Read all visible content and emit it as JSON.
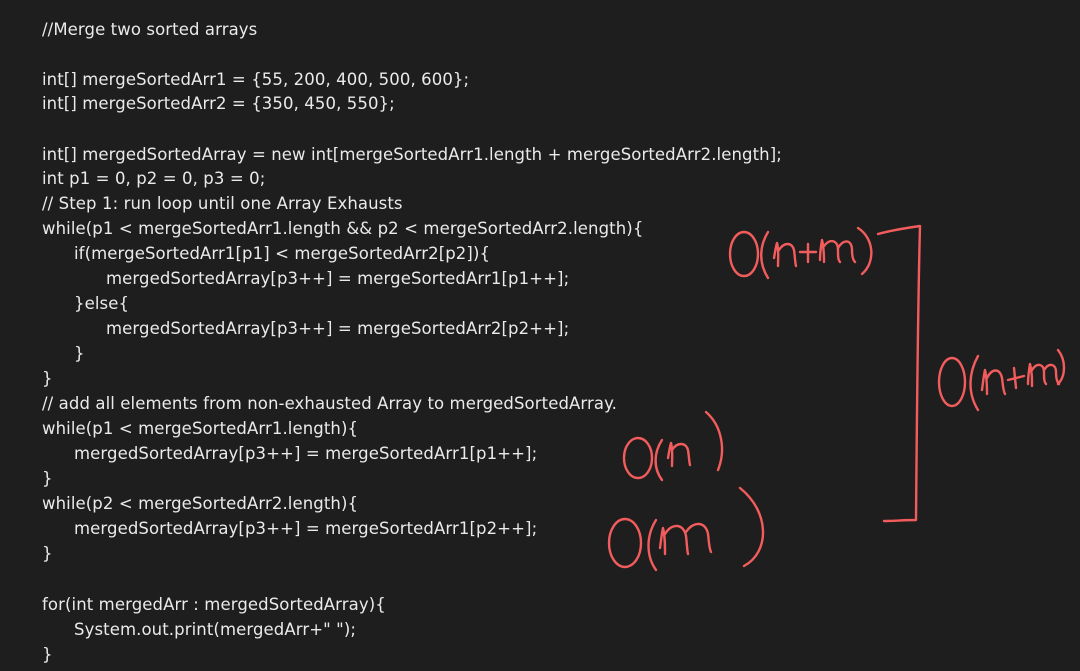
{
  "code": {
    "lines": [
      "//Merge two sorted arrays",
      "int[] mergeSortedArr1 = {55, 200, 400, 500, 600};",
      "int[] mergeSortedArr2 = {350, 450, 550};",
      "int[] mergedSortedArray = new int[mergeSortedArr1.length + mergeSortedArr2.length];",
      "int p1 = 0, p2 = 0, p3 = 0;",
      "// Step 1: run loop until one Array Exhausts",
      "while(p1 < mergeSortedArr1.length && p2 < mergeSortedArr2.length){",
      "if(mergeSortedArr1[p1] < mergeSortedArr2[p2]){",
      "mergedSortedArray[p3++] = mergeSortedArr1[p1++];",
      "}else{",
      "mergedSortedArray[p3++] = mergeSortedArr2[p2++];",
      "}",
      "}",
      "// add all elements from non-exhausted Array to mergedSortedArray.",
      "while(p1 < mergeSortedArr1.length){",
      "mergedSortedArray[p3++] = mergeSortedArr1[p1++];",
      "}",
      "while(p2 < mergeSortedArr2.length){",
      "mergedSortedArray[p3++] = mergeSortedArr1[p2++];",
      "}",
      "for(int mergedArr : mergedSortedArray){",
      "System.out.print(mergedArr+\" \");",
      "}"
    ]
  },
  "annotations": {
    "color": "#f25c5c",
    "first_loop_complexity": "O(n+m)",
    "second_loop_complexity": "O(n)",
    "third_loop_complexity": "O(m)",
    "total_complexity": "O(n+m)"
  },
  "colors": {
    "background": "#1e1e1e",
    "text": "#eaeaea"
  }
}
